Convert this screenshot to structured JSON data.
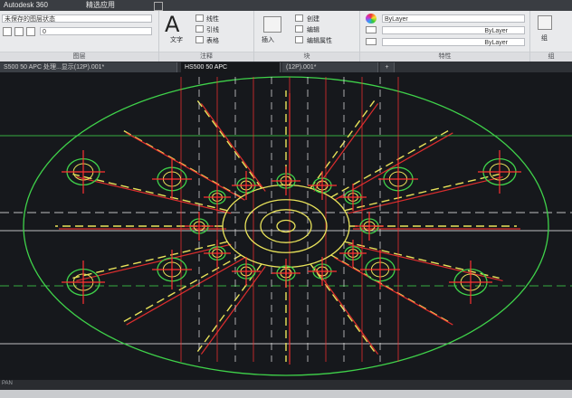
{
  "titlebar": {
    "app_name": "Autodesk 360",
    "featured_apps": "精选应用"
  },
  "ribbon": {
    "layer_state": "未保存的图层状态",
    "layer_current": "0",
    "text_label": "文字",
    "linear_label": "线性",
    "leader_label": "引线",
    "table_label": "表格",
    "insert_label": "插入",
    "create_label": "创建",
    "edit_label": "编辑",
    "edit_attr_label": "编辑属性",
    "bylayer_1": "ByLayer",
    "bylayer_2": "ByLayer",
    "bylayer_3": "ByLayer",
    "group_label": "组",
    "panels": {
      "layers": "图层",
      "annotation": "注释",
      "block": "块",
      "properties": "特性",
      "groups": "组"
    }
  },
  "tabs": [
    {
      "label": "S500 50 APC 处理...显示(12P).001*"
    },
    {
      "label": "HS500 50 APC"
    },
    {
      "label": "(12P).001*"
    }
  ],
  "status": {
    "command_hint": "PAN"
  },
  "colors": {
    "canvas_bg": "#16181c",
    "green": "#3fd24a",
    "yellow": "#e9e35a",
    "red": "#ff3131",
    "white": "#e8e8e8",
    "ribbon_bg": "#e9eaec"
  }
}
